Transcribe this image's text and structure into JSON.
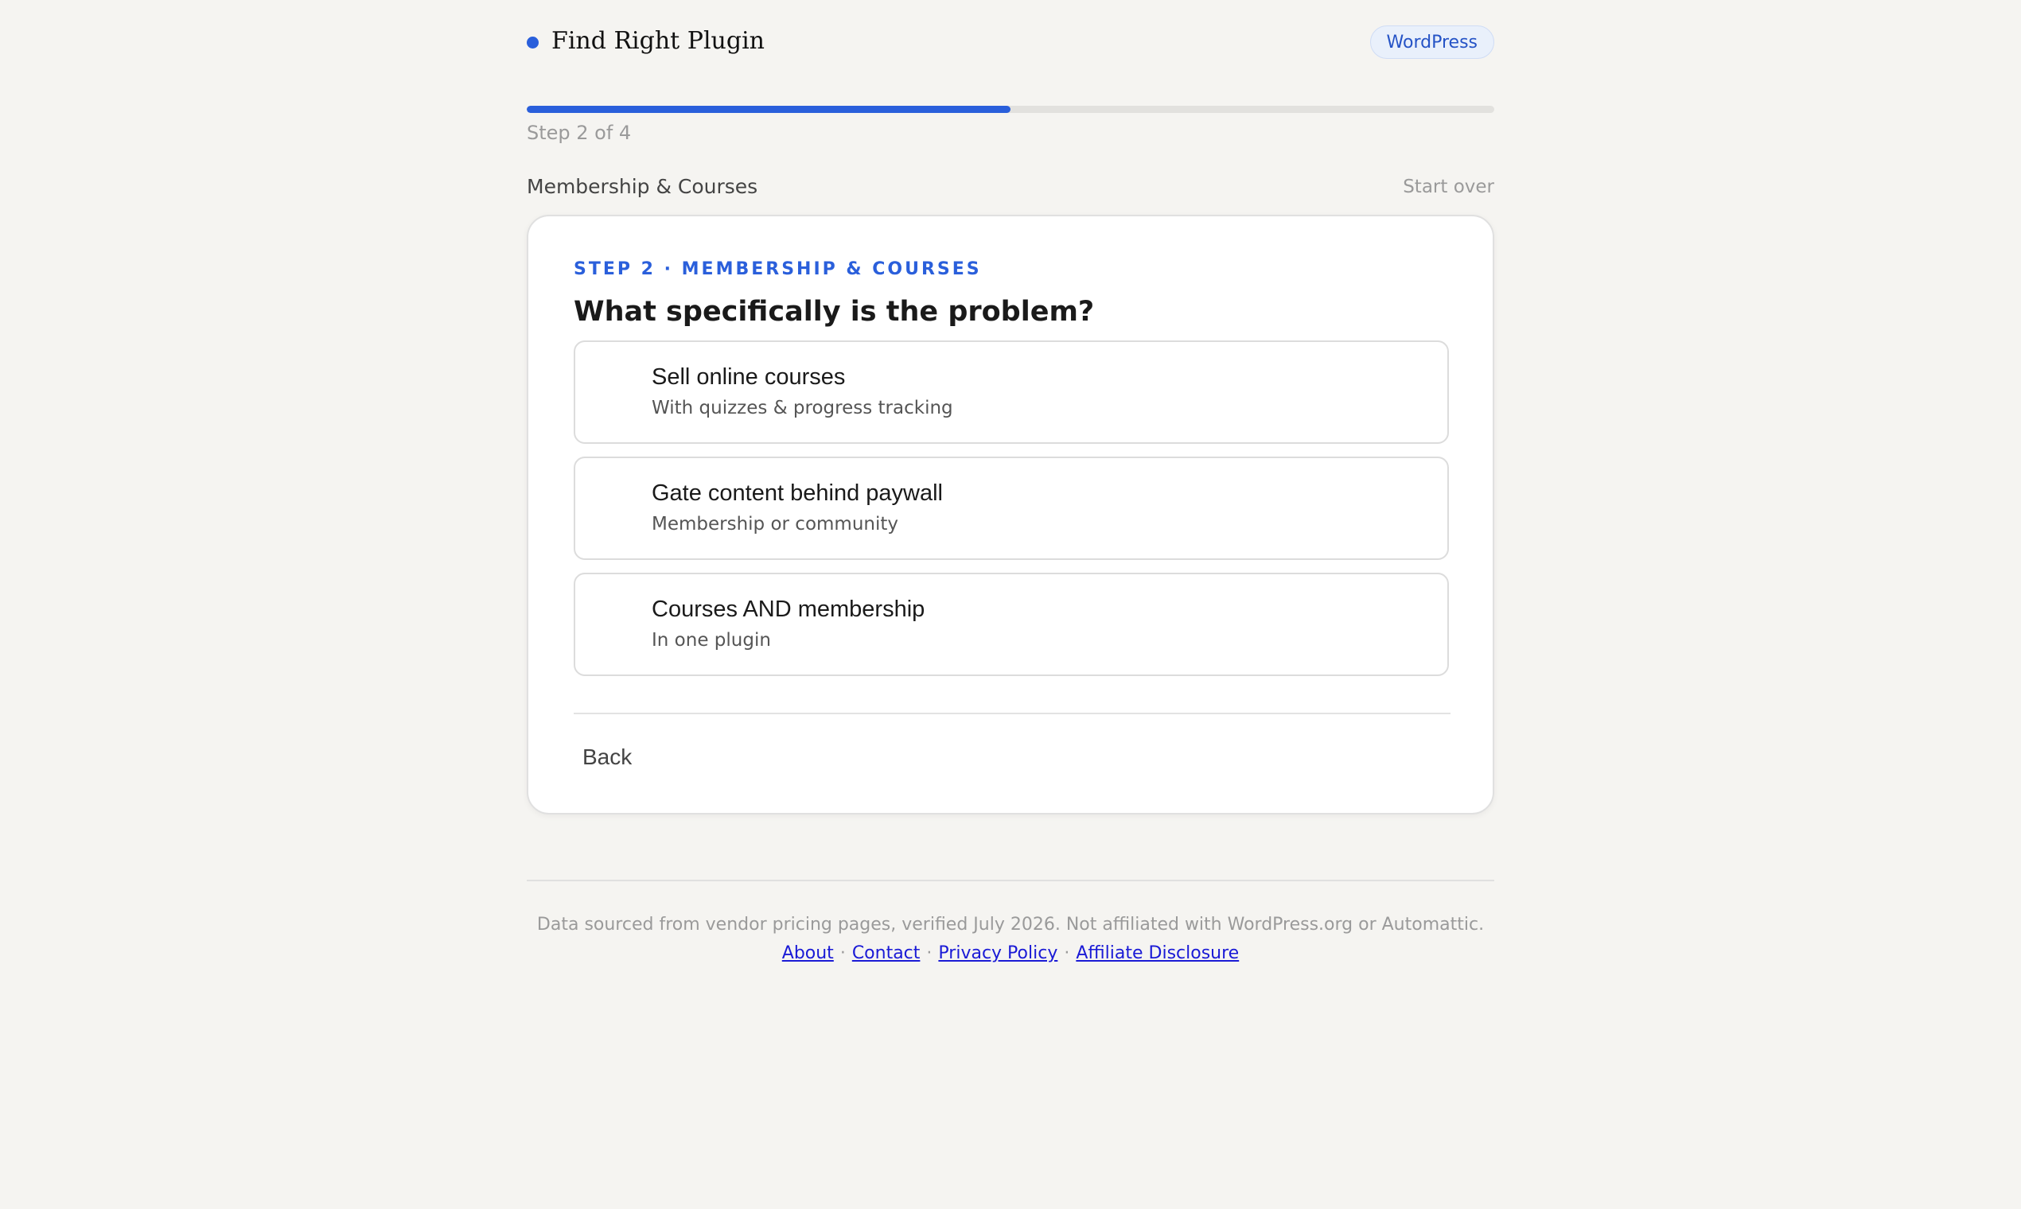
{
  "header": {
    "brand_name": "Find Right Plugin",
    "badge": "WordPress"
  },
  "progress": {
    "step_label": "Step 2 of 4",
    "fraction": 0.5
  },
  "section": {
    "name": "Membership & Courses",
    "start_over": "Start over"
  },
  "card": {
    "eyebrow": "STEP 2 · MEMBERSHIP & COURSES",
    "question": "What specifically is the problem?",
    "options": [
      {
        "title": "Sell online courses",
        "subtitle": "With quizzes & progress tracking"
      },
      {
        "title": "Gate content behind paywall",
        "subtitle": "Membership or community"
      },
      {
        "title": "Courses AND membership",
        "subtitle": "In one plugin"
      }
    ],
    "back_label": "Back"
  },
  "footer": {
    "note": "Data sourced from vendor pricing pages, verified July 2026. Not affiliated with WordPress.org or Automattic.",
    "links": [
      "About",
      "Contact",
      "Privacy Policy",
      "Affiliate Disclosure"
    ],
    "separator": "·"
  },
  "colors": {
    "accent": "#2a5fdb",
    "background": "#f5f4f1",
    "link": "#1a1ad6"
  }
}
